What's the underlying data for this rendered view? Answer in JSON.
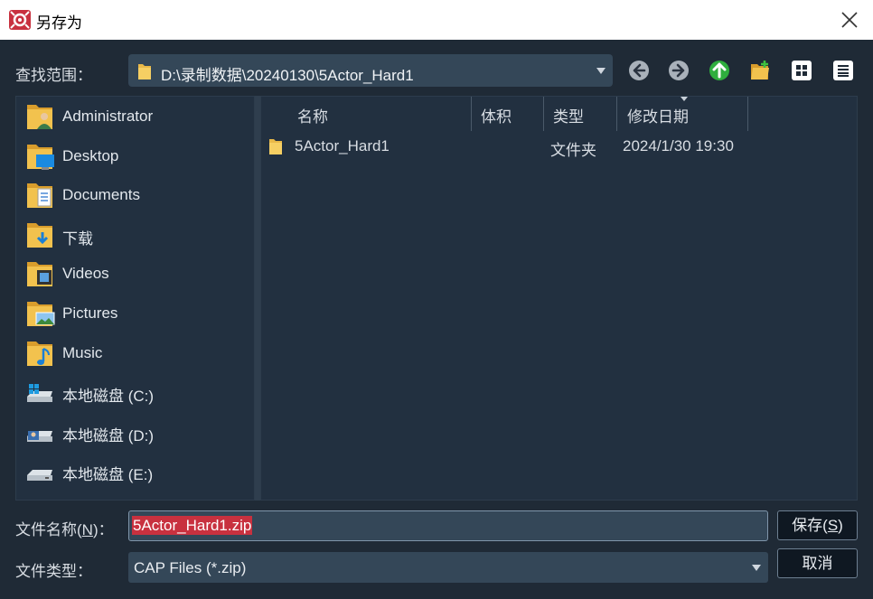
{
  "window": {
    "title": "另存为",
    "accent": "#c8313f"
  },
  "toolbar": {
    "look_in_label": "查找范围：",
    "path": "D:\\录制数据\\20240130\\5Actor_Hard1",
    "icons": [
      "back-icon",
      "forward-icon",
      "up-folder-icon",
      "new-folder-icon",
      "thumbnail-view-icon",
      "list-view-icon"
    ]
  },
  "places": [
    {
      "label": "Administrator",
      "icon": "user-folder-icon"
    },
    {
      "label": "Desktop",
      "icon": "desktop-folder-icon"
    },
    {
      "label": "Documents",
      "icon": "documents-folder-icon"
    },
    {
      "label": "下载",
      "icon": "downloads-folder-icon"
    },
    {
      "label": "Videos",
      "icon": "videos-folder-icon"
    },
    {
      "label": "Pictures",
      "icon": "pictures-folder-icon"
    },
    {
      "label": "Music",
      "icon": "music-folder-icon"
    },
    {
      "label": "本地磁盘 (C:)",
      "icon": "drive-c-icon"
    },
    {
      "label": "本地磁盘 (D:)",
      "icon": "drive-d-icon"
    },
    {
      "label": "本地磁盘 (E:)",
      "icon": "drive-e-icon"
    }
  ],
  "columns": {
    "name": "名称",
    "size": "体积",
    "type": "类型",
    "modified": "修改日期"
  },
  "files": [
    {
      "name": "5Actor_Hard1",
      "size": "",
      "type": "文件夹",
      "modified": "2024/1/30 19:30"
    }
  ],
  "footer": {
    "filename_label_pre": "文件名称(",
    "filename_label_key": "N",
    "filename_label_post": ")：",
    "filename_value": "5Actor_Hard1.zip",
    "filetype_label": "文件类型：",
    "filetype_value": "CAP Files (*.zip)",
    "save_pre": "保存(",
    "save_key": "S",
    "save_post": ")",
    "cancel_label": "取消"
  }
}
